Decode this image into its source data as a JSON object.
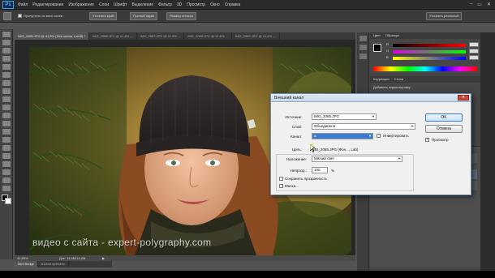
{
  "app": {
    "logo": "Ps"
  },
  "menu": [
    "Файл",
    "Редактирование",
    "Изображение",
    "Слои",
    "Шрифт",
    "Выделение",
    "Фильтр",
    "3D",
    "Просмотр",
    "Окно",
    "Справка"
  ],
  "window_controls": [
    "–",
    "▭",
    "✕"
  ],
  "options_bar": {
    "checkbox_label": "Пропустить из всех слоев",
    "btn1": "Уточнить край",
    "btn2": "Полный экран",
    "btn3": "Размер оттиска",
    "btn4": "Уточнить реальный"
  },
  "tabs": [
    {
      "label": "IMG_2085.JPG @ 41,8% (Фон копия, Lab/8) *",
      "active": true
    },
    {
      "label": "IMG_2086.JPG @ 41,8% ...",
      "active": false
    },
    {
      "label": "IMG_2087.JPG @ 41,8% ...",
      "active": false
    },
    {
      "label": "IMG_2088.JPG @ 41,8% ...",
      "active": false
    },
    {
      "label": "IMG_2089.JPG @ 41,8% ...",
      "active": false
    }
  ],
  "status": {
    "zoom": "41,89%",
    "doc": "Док: 14,4M/14,4M"
  },
  "bottom_tabs": [
    "Mini Bridge",
    "Шкала времени"
  ],
  "panels": {
    "color_tab": "Цвет",
    "swatches_tab": "Образцы",
    "sliders": [
      {
        "label": "R",
        "value": ""
      },
      {
        "label": "G",
        "value": ""
      },
      {
        "label": "B",
        "value": ""
      }
    ],
    "corrections_tab": "Коррекция",
    "styles_tab": "Стили",
    "add_correction": "Добавить корректировку"
  },
  "dialog": {
    "title": "Внешний канал",
    "close": "✕",
    "source_label": "Источник:",
    "source_value": "IMG_2085.JPG",
    "layer_label": "Слой:",
    "layer_value": "Объединено",
    "channel_label": "Канал:",
    "channel_value": "a",
    "invert_label": "Инвертировать",
    "target_label": "Цель:",
    "target_value": "IMG_2085.JPG (Фон..., Lab)",
    "blending_label": "Наложение:",
    "blending_value": "Мягкий свет",
    "opacity_label": "Непрозр.:",
    "opacity_value": "100",
    "opacity_unit": "%",
    "preserve_label": "Сохранить прозрачность",
    "mask_label": "Маска...",
    "ok": "OK",
    "cancel": "Отмена",
    "preview_label": "Просмотр",
    "preview_checked": true,
    "invert_checked": false,
    "preserve_checked": false,
    "mask_checked": false
  },
  "watermark": "видео с сайта - expert-polygraphy.com"
}
